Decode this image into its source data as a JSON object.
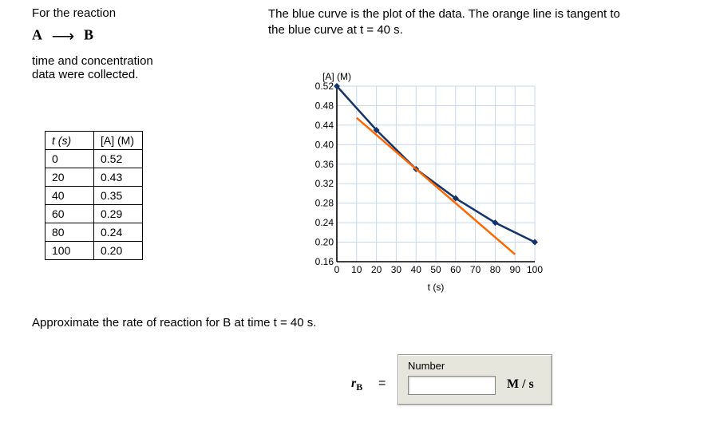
{
  "intro": {
    "line1": "For the reaction",
    "species_A": "A",
    "species_B": "B",
    "line2a": "time and concentration",
    "line2b": "data were collected."
  },
  "caption": {
    "line1": "The blue curve is the plot of the data. The orange line is tangent to",
    "line2": "the blue curve at t = 40 s."
  },
  "table": {
    "headers": {
      "t": "t (s)",
      "A": "[A] (M)"
    },
    "rows": [
      {
        "t": "0",
        "A": "0.52"
      },
      {
        "t": "20",
        "A": "0.43"
      },
      {
        "t": "40",
        "A": "0.35"
      },
      {
        "t": "60",
        "A": "0.29"
      },
      {
        "t": "80",
        "A": "0.24"
      },
      {
        "t": "100",
        "A": "0.20"
      }
    ]
  },
  "question": "Approximate the rate of reaction for B at time t = 40 s.",
  "answer": {
    "symbol": "r",
    "subscript": "B",
    "equals": "=",
    "box_label": "Number",
    "value": "",
    "unit": "M / s"
  },
  "chart_data": {
    "type": "line",
    "title": "",
    "xlabel": "t (s)",
    "ylabel": "[A] (M)",
    "xlim": [
      0,
      100
    ],
    "ylim": [
      0.16,
      0.52
    ],
    "xticks": [
      0,
      10,
      20,
      30,
      40,
      50,
      60,
      70,
      80,
      90,
      100
    ],
    "yticks": [
      0.16,
      0.2,
      0.24,
      0.28,
      0.32,
      0.36,
      0.4,
      0.44,
      0.48,
      0.52
    ],
    "series": [
      {
        "name": "blue",
        "color": "#14356b",
        "x": [
          0,
          20,
          40,
          60,
          80,
          100
        ],
        "y": [
          0.52,
          0.43,
          0.35,
          0.29,
          0.24,
          0.2
        ],
        "markers": true
      },
      {
        "name": "tangent",
        "color": "#ff6600",
        "x": [
          10,
          90
        ],
        "y": [
          0.455,
          0.175
        ],
        "markers": false
      }
    ]
  }
}
